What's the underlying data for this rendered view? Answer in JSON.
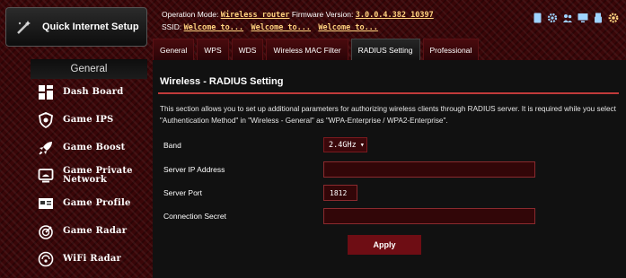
{
  "sidebar": {
    "brand_label": "Quick Internet Setup",
    "section_label": "General",
    "items": [
      {
        "label": "Dash Board",
        "icon": "dashboard-icon"
      },
      {
        "label": "Game IPS",
        "icon": "shield-icon"
      },
      {
        "label": "Game Boost",
        "icon": "rocket-icon"
      },
      {
        "label": "Game Private Network",
        "icon": "monitor-icon"
      },
      {
        "label": "Game Profile",
        "icon": "profile-icon"
      },
      {
        "label": "Game Radar",
        "icon": "radar-icon"
      },
      {
        "label": "WiFi Radar",
        "icon": "wifi-radar-icon"
      }
    ]
  },
  "status": {
    "op_mode_label": "Operation Mode:",
    "op_mode_value": "Wireless router",
    "fw_label": "Firmware Version:",
    "fw_value": "3.0.0.4.382_10397",
    "ssid_label": "SSID:",
    "ssid_values": [
      "Welcome to...",
      "Welcome to...",
      "Welcome to..."
    ]
  },
  "top_icons": [
    "mobile-icon",
    "settings-gear-icon",
    "users-icon",
    "monitor-icon",
    "usb-icon",
    "gear-icon"
  ],
  "tabs": [
    {
      "label": "General",
      "active": false
    },
    {
      "label": "WPS",
      "active": false
    },
    {
      "label": "WDS",
      "active": false
    },
    {
      "label": "Wireless MAC Filter",
      "active": false
    },
    {
      "label": "RADIUS Setting",
      "active": true
    },
    {
      "label": "Professional",
      "active": false
    }
  ],
  "panel": {
    "title": "Wireless - RADIUS Setting",
    "description": "This section allows you to set up additional parameters for authorizing wireless clients through RADIUS server. It is required while you select \"Authentication Method\" in \"Wireless - General\" as \"WPA-Enterprise / WPA2-Enterprise\".",
    "band_label": "Band",
    "band_value": "2.4GHz",
    "server_ip_label": "Server IP Address",
    "server_ip_value": "",
    "server_port_label": "Server Port",
    "server_port_value": "1812",
    "secret_label": "Connection Secret",
    "secret_value": "",
    "apply_label": "Apply"
  },
  "colors": {
    "accent": "#c03a3a",
    "background": "#3a0608",
    "panel": "#111111",
    "button": "#6e0d14",
    "link": "#ffd27f"
  }
}
